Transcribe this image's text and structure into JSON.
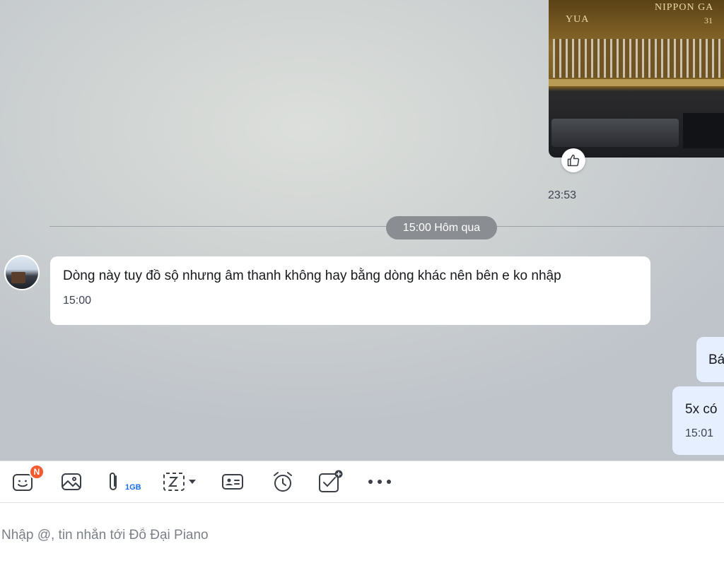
{
  "messages": {
    "sent_photo_time": "23:53",
    "date_separator": "15:00 Hôm qua",
    "incoming": {
      "text": "Dòng này tuy đồ sộ nhưng âm thanh không hay bằng dòng khác nên bên e ko nhập",
      "time": "15:00"
    },
    "outgoing": [
      {
        "text": "Bá"
      },
      {
        "text": "5x có",
        "time": "15:01"
      }
    ]
  },
  "photo": {
    "brand_left": "YUA",
    "brand_top": "NIPPON GA",
    "brand_num": "31"
  },
  "toolbar": {
    "sticker_badge": "N",
    "attach_size_label": "1GB",
    "icons": [
      "sticker-icon",
      "image-icon",
      "attachment-icon",
      "screenshot-icon",
      "contact-card-icon",
      "reminder-icon",
      "task-icon",
      "more-icon"
    ]
  },
  "composer": {
    "placeholder": "Nhập @, tin nhắn tới Đỗ Đại Piano"
  },
  "colors": {
    "badge": "#f25a2f",
    "outgoing_bubble": "#e5efff",
    "size_label": "#1a6ee8"
  }
}
